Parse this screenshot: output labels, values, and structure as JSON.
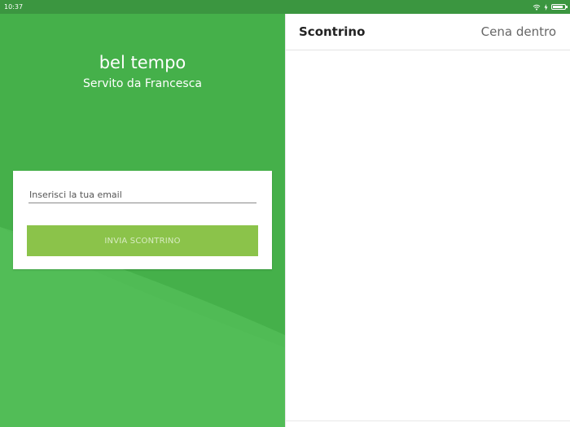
{
  "status_bar": {
    "time": "10:37",
    "icons": [
      "wifi-icon",
      "charging-icon",
      "battery-icon"
    ]
  },
  "left": {
    "restaurant_name": "bel tempo",
    "server_line": "Servito da Francesca",
    "email_placeholder": "Inserisci la tua email",
    "email_value": "",
    "send_button_label": "INVIA SCONTRINO"
  },
  "right": {
    "title": "Scontrino",
    "order_type": "Cena dentro"
  },
  "colors": {
    "status_bar": "#3b9640",
    "panel_green": "#45b04a",
    "button_green": "#8bc34a",
    "button_text": "#d8ecc2"
  }
}
